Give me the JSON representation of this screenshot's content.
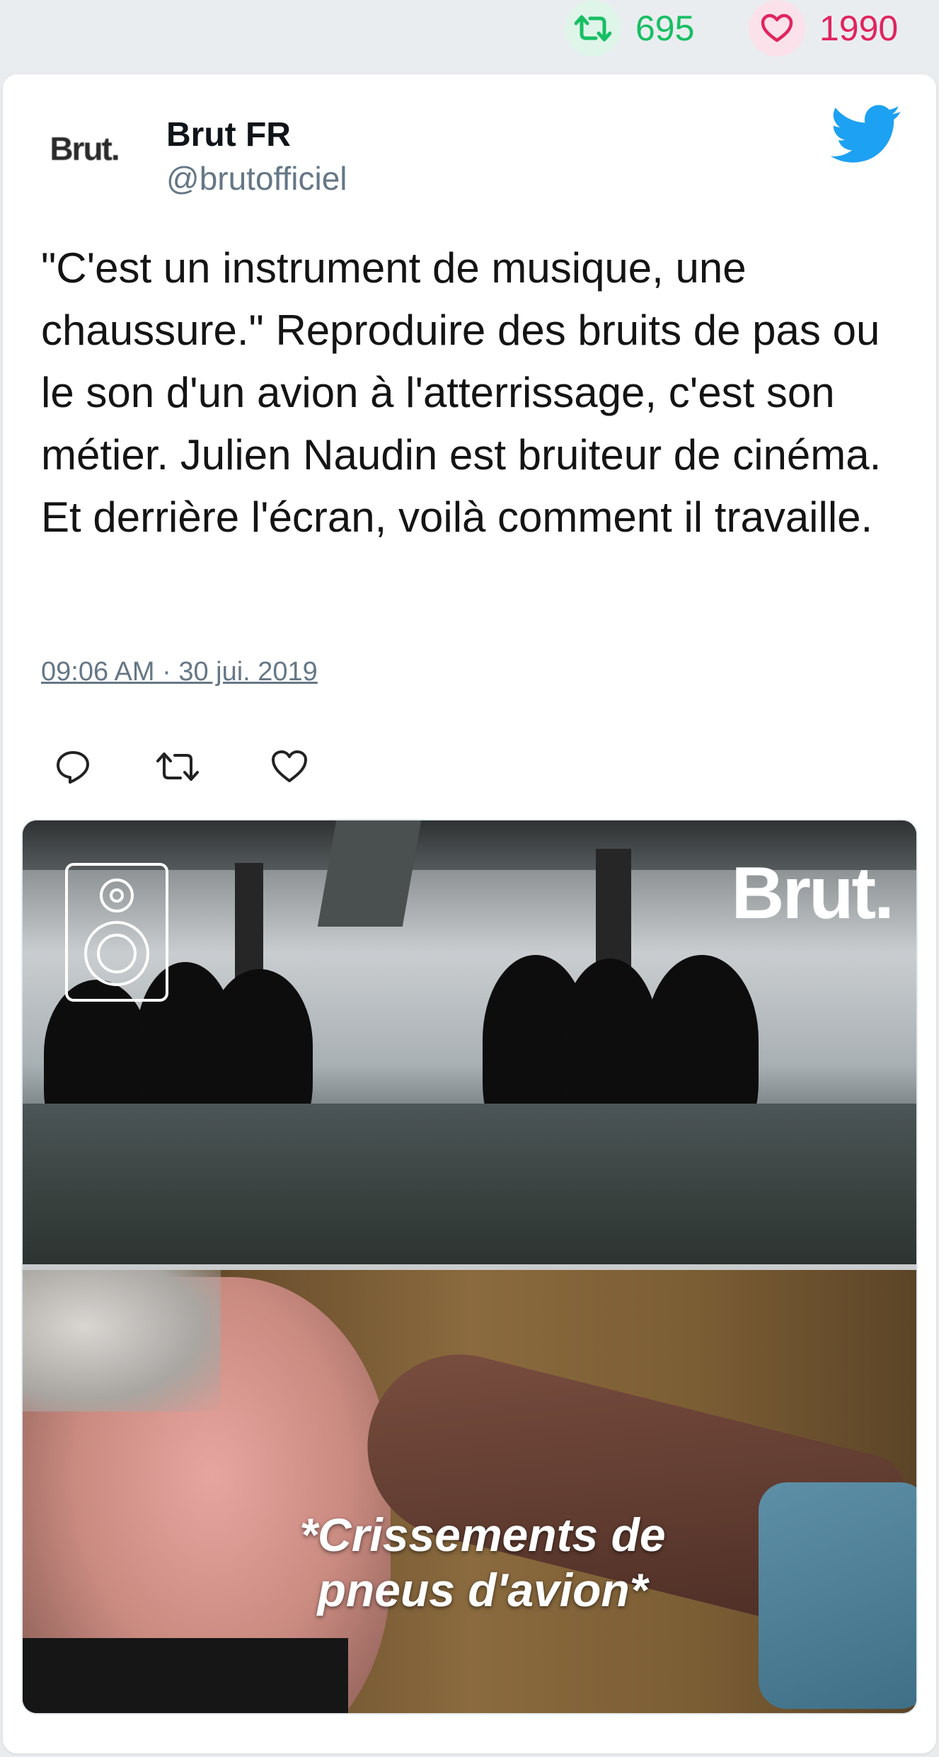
{
  "stats": {
    "retweets": "695",
    "likes": "1990",
    "retweet_color": "#17bf63",
    "like_color": "#e0245e"
  },
  "tweet": {
    "author_name": "Brut FR",
    "author_handle": "@brutofficiel",
    "avatar_logo_text": "Brut.",
    "text": "\"C'est un instrument de musique, une chaussure.\" Reproduire des bruits de pas ou le son d'un avion à l'atterrissage, c'est son métier. Julien Naudin est bruiteur de cinéma. Et derrière l'écran, voilà comment il travaille.",
    "timestamp": "09:06 AM · 30 jui. 2019",
    "platform_icon": "twitter-bird-icon",
    "platform_color": "#1da1f2"
  },
  "actions": {
    "reply_icon": "reply-icon",
    "retweet_icon": "retweet-icon",
    "like_icon": "heart-icon"
  },
  "media": {
    "watermark": "Brut.",
    "caption": "*Crissements de pneus d'avion*",
    "overlay_icon": "speaker-icon"
  }
}
